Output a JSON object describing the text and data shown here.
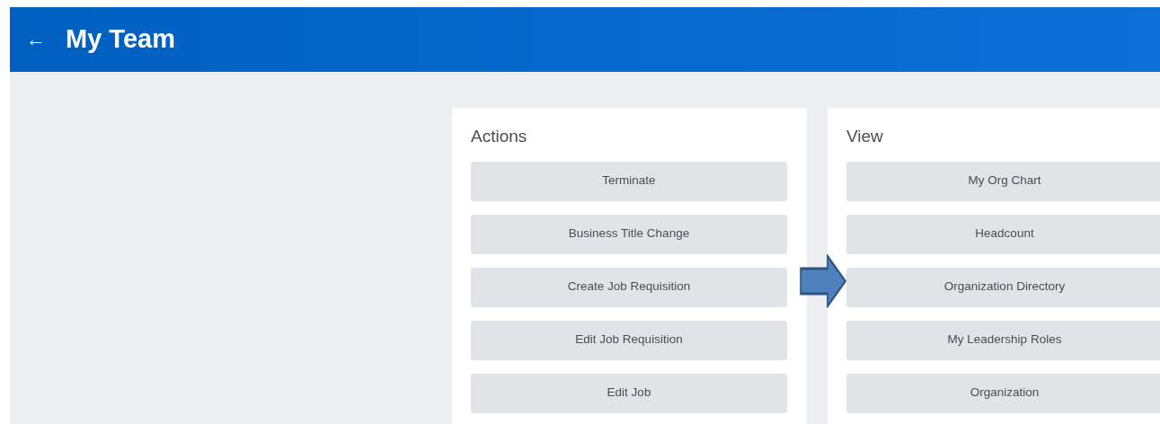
{
  "header": {
    "back": "←",
    "title": "My Team"
  },
  "panels": [
    {
      "title": "Actions",
      "items": [
        {
          "label": "Terminate",
          "pointed": false
        },
        {
          "label": "Business Title Change",
          "pointed": false
        },
        {
          "label": "Create Job Requisition",
          "pointed": false
        },
        {
          "label": "Edit Job Requisition",
          "pointed": false
        },
        {
          "label": "Edit Job",
          "pointed": false
        }
      ]
    },
    {
      "title": "View",
      "items": [
        {
          "label": "My Org Chart",
          "pointed": false
        },
        {
          "label": "Headcount",
          "pointed": false
        },
        {
          "label": "Organization Directory",
          "pointed": true
        },
        {
          "label": "My Leadership Roles",
          "pointed": false
        },
        {
          "label": "Organization",
          "pointed": false
        }
      ]
    }
  ]
}
